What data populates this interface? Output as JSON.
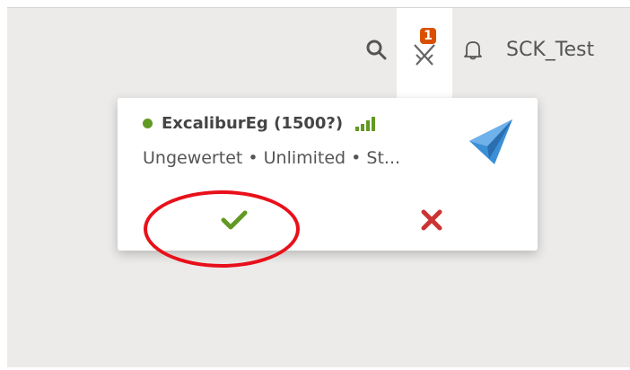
{
  "header": {
    "username": "SCK_Test",
    "challenge_count": "1"
  },
  "challenge_popup": {
    "opponent": "ExcaliburEg (1500?)",
    "details": "Ungewertet • Unlimited • St...",
    "status_color": "#629924"
  },
  "colors": {
    "accept": "#629924",
    "decline": "#cc3333",
    "badge": "#d85000",
    "highlight": "#e8101a"
  },
  "icons": {
    "search": "search-icon",
    "challenge": "crossed-swords-icon",
    "notifications": "bell-icon",
    "game_type": "paper-plane-icon",
    "accept": "check-icon",
    "decline": "x-icon"
  }
}
